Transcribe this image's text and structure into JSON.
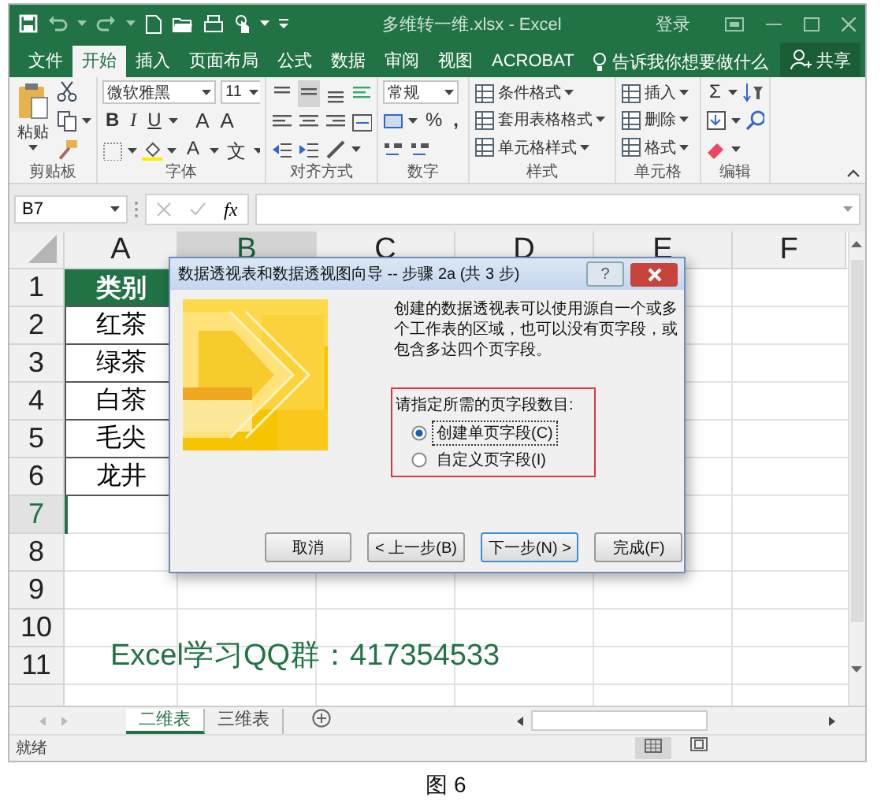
{
  "window": {
    "title": "多维转一维.xlsx - Excel",
    "sign_in": "登录"
  },
  "ribbon_tabs": [
    {
      "label": "文件",
      "selected": false
    },
    {
      "label": "开始",
      "selected": true
    },
    {
      "label": "插入",
      "selected": false
    },
    {
      "label": "页面布局",
      "selected": false
    },
    {
      "label": "公式",
      "selected": false
    },
    {
      "label": "数据",
      "selected": false
    },
    {
      "label": "审阅",
      "selected": false
    },
    {
      "label": "视图",
      "selected": false
    },
    {
      "label": "ACROBAT",
      "selected": false
    }
  ],
  "tell_me": "告诉我你想要做什么",
  "share": "共享",
  "ribbon": {
    "groups": [
      {
        "kind": "clipboard",
        "label": "剪贴板",
        "paste": "粘贴"
      },
      {
        "kind": "font",
        "label": "字体",
        "font_name": "微软雅黑",
        "font_size": "11",
        "buttons": [
          {
            "kind": "bold",
            "label": "B"
          },
          {
            "kind": "italic",
            "label": "I"
          },
          {
            "kind": "underline",
            "label": "U"
          },
          {
            "kind": "grow",
            "label": "A"
          },
          {
            "kind": "shrink",
            "label": "A"
          },
          {
            "kind": "font-color",
            "label": "A"
          },
          {
            "kind": "phonetic",
            "label": "文"
          }
        ]
      },
      {
        "kind": "align",
        "label": "对齐方式"
      },
      {
        "kind": "number",
        "label": "数字",
        "format": "常规",
        "percent": "%",
        "comma": ","
      },
      {
        "kind": "list",
        "label": "样式",
        "items": [
          "条件格式",
          "套用表格格式",
          "单元格样式"
        ]
      },
      {
        "kind": "list",
        "label": "单元格",
        "items": [
          "插入",
          "删除",
          "格式"
        ]
      },
      {
        "kind": "edit",
        "label": "编辑",
        "sum": "Σ"
      }
    ]
  },
  "formula_bar": {
    "name_box": "B7",
    "fx": "fx"
  },
  "grid": {
    "columns": [
      {
        "label": "A",
        "selected": false
      },
      {
        "label": "B",
        "selected": true
      },
      {
        "label": "C",
        "selected": false
      },
      {
        "label": "D",
        "selected": false
      },
      {
        "label": "E",
        "selected": false
      },
      {
        "label": "F",
        "selected": false
      }
    ],
    "rows": [
      {
        "label": "1",
        "selected": false,
        "cells": [
          {
            "kind": "header",
            "text": "类别"
          }
        ]
      },
      {
        "label": "2",
        "selected": false,
        "cells": [
          {
            "kind": "value",
            "text": "红茶"
          }
        ]
      },
      {
        "label": "3",
        "selected": false,
        "cells": [
          {
            "kind": "value",
            "text": "绿茶"
          }
        ]
      },
      {
        "label": "4",
        "selected": false,
        "cells": [
          {
            "kind": "value",
            "text": "白茶"
          }
        ]
      },
      {
        "label": "5",
        "selected": false,
        "cells": [
          {
            "kind": "value",
            "text": "毛尖"
          }
        ]
      },
      {
        "label": "6",
        "selected": false,
        "cells": [
          {
            "kind": "value",
            "text": "龙井"
          }
        ]
      },
      {
        "label": "7",
        "selected": true,
        "cells": []
      },
      {
        "label": "8",
        "selected": false,
        "cells": []
      },
      {
        "label": "9",
        "selected": false,
        "cells": []
      },
      {
        "label": "10",
        "selected": false,
        "cells": []
      },
      {
        "label": "11",
        "selected": false,
        "cells": []
      }
    ],
    "note": "Excel学习QQ群：417354533"
  },
  "sheet_tabs": [
    {
      "label": "二维表",
      "selected": true
    },
    {
      "label": "三维表",
      "selected": false
    }
  ],
  "status_bar": {
    "text": "就绪"
  },
  "dialog": {
    "title": "数据透视表和数据透视图向导 -- 步骤 2a (共 3 步)",
    "help": "?",
    "description": "创建的数据透视表可以使用源自一个或多个工作表的区域，也可以没有页字段，或包含多达四个页字段。",
    "group_label": "请指定所需的页字段数目:",
    "options": [
      {
        "label": "创建单页字段(C)",
        "selected": true
      },
      {
        "label": "自定义页字段(I)",
        "selected": false
      }
    ],
    "buttons": [
      {
        "label": "取消",
        "default": false
      },
      {
        "label": "< 上一步(B)",
        "default": false
      },
      {
        "label": "下一步(N) >",
        "default": true
      },
      {
        "label": "完成(F)",
        "default": false
      }
    ]
  },
  "caption": "图 6"
}
